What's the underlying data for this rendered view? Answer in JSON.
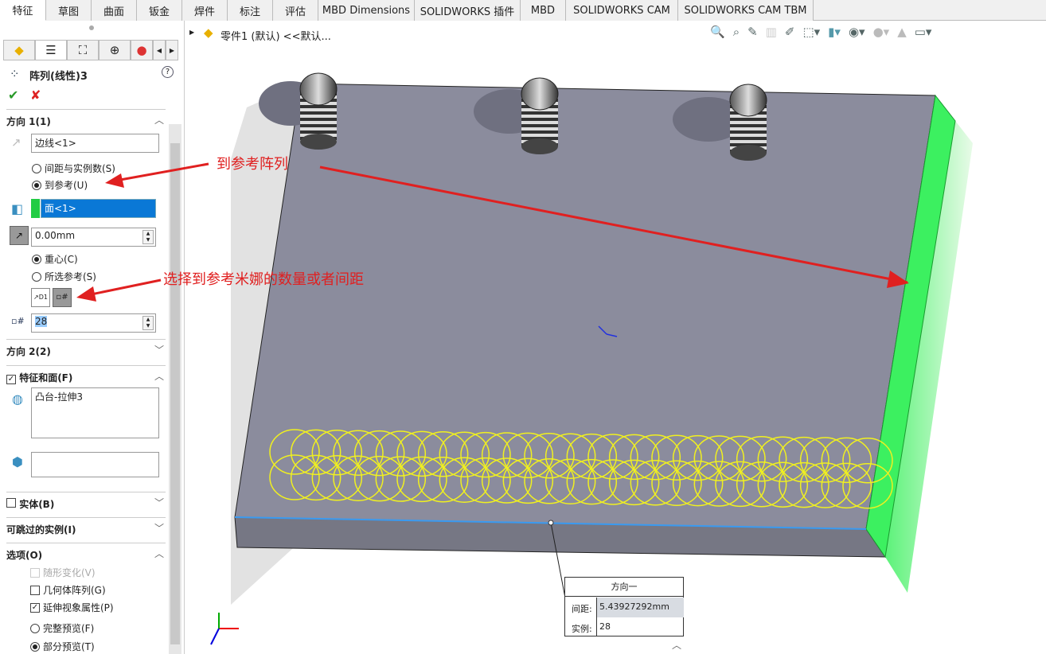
{
  "tabs": [
    "特征",
    "草图",
    "曲面",
    "钣金",
    "焊件",
    "标注",
    "评估",
    "MBD Dimensions",
    "SOLIDWORKS 插件",
    "MBD",
    "SOLIDWORKS CAM",
    "SOLIDWORKS CAM TBM"
  ],
  "breadcrumb": "零件1 (默认) <<默认...",
  "panel": {
    "title": "阵列(线性)3",
    "dir1": {
      "header": "方向 1(1)",
      "edge": "边线<1>",
      "opt_spacing": "间距与实例数(S)",
      "opt_ref": "到参考(U)",
      "face": "面<1>",
      "offset": "0.00mm",
      "opt_centroid": "重心(C)",
      "opt_selected": "所选参考(S)",
      "count": "28"
    },
    "dir2": {
      "header": "方向 2(2)"
    },
    "features": {
      "header": "特征和面(F)",
      "item": "凸台-拉伸3"
    },
    "bodies": {
      "header": "实体(B)"
    },
    "skip": {
      "header": "可跳过的实例(I)"
    },
    "options": {
      "header": "选项(O)",
      "vary": "随形变化(V)",
      "geometry": "几何体阵列(G)",
      "propagate": "延伸视象属性(P)",
      "full": "完整预览(F)",
      "partial": "部分预览(T)"
    }
  },
  "annotations": {
    "a1": "到参考阵列",
    "a2": "选择到参考米娜的数量或者间距"
  },
  "callout": {
    "title": "方向一",
    "spacing_label": "间距:",
    "spacing": "5.43927292mm",
    "count_label": "实例:",
    "count": "28"
  },
  "colors": {
    "accent": "#0078d7",
    "face_green": "#3cf060",
    "annot": "#e02020",
    "preview": "#f0f020"
  }
}
